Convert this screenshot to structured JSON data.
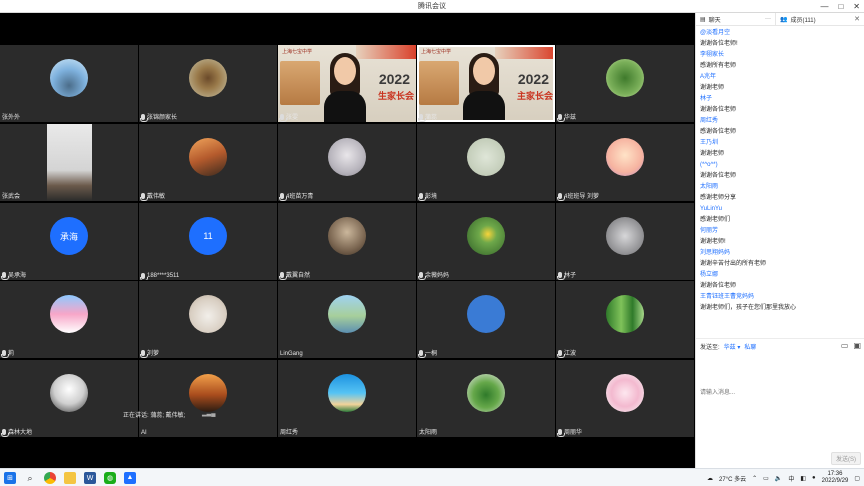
{
  "window": {
    "title": "腾讯会议",
    "controls": [
      "—",
      "□",
      "✕"
    ]
  },
  "tiles": [
    {
      "name": "张外外",
      "mic": false,
      "avatar": "av-sky"
    },
    {
      "name": "张锦颜家长",
      "mic": true,
      "avatar": "av-palm"
    },
    {
      "name": "张雯",
      "mic": true,
      "presenter": true,
      "year": "2022",
      "banner": "生家长会",
      "logo": "上海七宝中学"
    },
    {
      "name": "蒲蕊",
      "mic": true,
      "presenter": true,
      "speaking": true,
      "year": "2022",
      "banner": "主家长会",
      "logo": "上海七宝中学"
    },
    {
      "name": "华兹",
      "mic": true,
      "avatar": "av-tree"
    },
    {
      "name": "张武会",
      "mic": false,
      "kid": true
    },
    {
      "name": "戴伟敏",
      "mic": true,
      "avatar": "av-rail"
    },
    {
      "name": "4班苗万青",
      "mic": true,
      "avatar": "av-girl"
    },
    {
      "name": "彭境",
      "mic": true,
      "avatar": "av-sketch"
    },
    {
      "name": "4班班导 刘萝",
      "mic": true,
      "avatar": "av-anime"
    },
    {
      "name": "吴承海",
      "mic": true,
      "initial": "承海"
    },
    {
      "name": "188****3511",
      "mic": true,
      "initial": "11"
    },
    {
      "name": "戴翼自然",
      "mic": true,
      "avatar": "av-hat"
    },
    {
      "name": "余薇妈妈",
      "mic": true,
      "avatar": "av-flower"
    },
    {
      "name": "林子",
      "mic": true,
      "avatar": "av-grey"
    },
    {
      "name": "莉",
      "mic": true,
      "avatar": "av-taj"
    },
    {
      "name": "刘萝",
      "mic": true,
      "avatar": "av-cat"
    },
    {
      "name": "LinGang",
      "mic": false,
      "avatar": "av-lake"
    },
    {
      "name": "一桐",
      "mic": true,
      "avatar": "av-blue"
    },
    {
      "name": "江波",
      "mic": true,
      "avatar": "av-bamboo"
    },
    {
      "name": "森林大地",
      "mic": true,
      "avatar": "av-mountain"
    },
    {
      "name": "AI",
      "mic": false,
      "avatar": "av-sunset"
    },
    {
      "name": "周红秀",
      "mic": false,
      "avatar": "av-beach"
    },
    {
      "name": "太阳雨",
      "mic": false,
      "avatar": "av-plant"
    },
    {
      "name": "周丽华",
      "mic": true,
      "avatar": "av-blossom"
    }
  ],
  "speaking_label": "正在讲话: 蒲蕊; 戴伟敏;",
  "chat": {
    "tab_chat": "聊天",
    "tab_more": "···",
    "tab_members": "成员(111)",
    "close": "✕",
    "messages": [
      {
        "name": "@淡看月空",
        "text": "谢谢各位老师!"
      },
      {
        "name": "李栩家长",
        "text": "感谢所有老师"
      },
      {
        "name": "A兆年",
        "text": "谢谢老师"
      },
      {
        "name": "林子",
        "text": "谢谢各位老师"
      },
      {
        "name": "周红秀",
        "text": "感谢各位老师"
      },
      {
        "name": "王乃圳",
        "text": "谢谢老师"
      },
      {
        "name": "(*^o^*)",
        "text": "谢谢各位老师"
      },
      {
        "name": "太阳雨",
        "text": "感谢老师分享"
      },
      {
        "name": "YuLinYu",
        "text": "感谢老师们"
      },
      {
        "name": "何丽芳",
        "text": "谢谢老师!"
      },
      {
        "name": "刘思翔妈妈",
        "text": "谢谢辛苦付出的所有老师"
      },
      {
        "name": "杨立娜",
        "text": "谢谢各位老师"
      },
      {
        "name": "王青钰班王曹竞妈妈",
        "text": "谢谢老师们，孩子在您们那里我放心"
      }
    ],
    "send_to_label": "发送至:",
    "send_to_target": "华兹 ▾",
    "private": "私聊",
    "input_placeholder": "请输入消息...",
    "send_button": "发送(S)"
  },
  "taskbar": {
    "weather": "27°C 多云",
    "ime": "中",
    "time": "17:36",
    "date": "2022/9/29"
  }
}
